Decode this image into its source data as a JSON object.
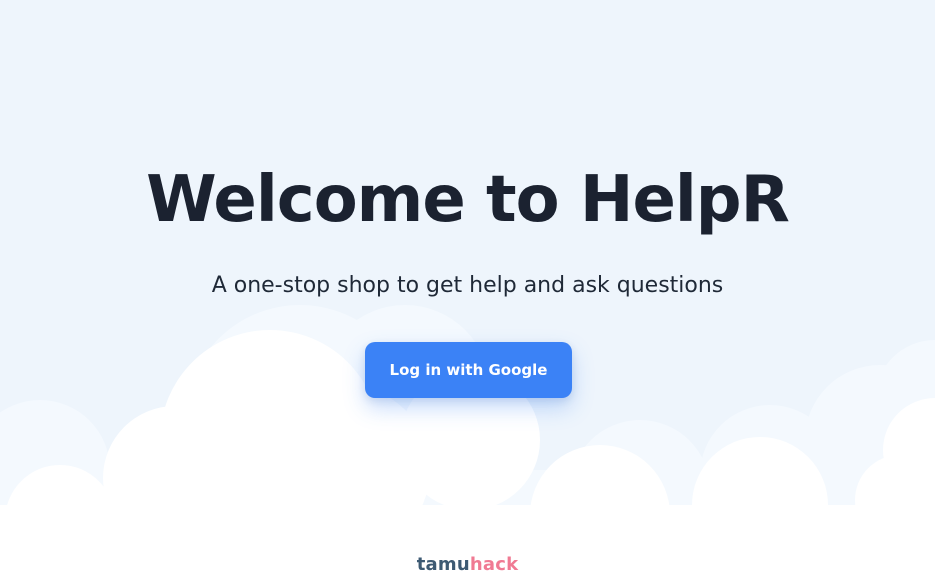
{
  "hero": {
    "title": "Welcome to HelpR",
    "subtitle": "A one-stop shop to get help and ask questions",
    "login_label": "Log in with Google"
  },
  "footer": {
    "brand_part1": "tamu",
    "brand_part2": "hack"
  },
  "colors": {
    "background": "#eef5fc",
    "cloud_light": "#f4f9fe",
    "cloud": "#ffffff",
    "button": "#3b82f6",
    "title": "#1b2230",
    "brand_primary": "#3d5a73",
    "brand_accent": "#f07a93"
  }
}
